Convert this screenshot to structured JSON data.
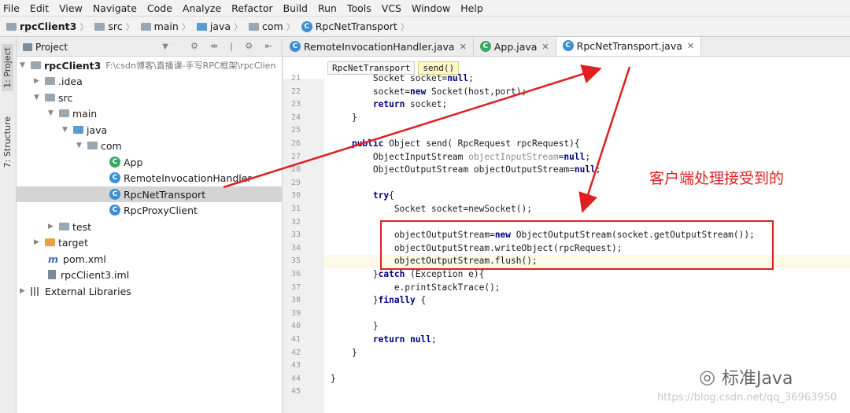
{
  "menu": [
    "File",
    "Edit",
    "View",
    "Navigate",
    "Code",
    "Analyze",
    "Refactor",
    "Build",
    "Run",
    "Tools",
    "VCS",
    "Window",
    "Help"
  ],
  "breadcrumbs": [
    "rpcClient3",
    "src",
    "main",
    "java",
    "com",
    "RpcNetTransport"
  ],
  "side_tabs": {
    "project": "1: Project",
    "structure": "7: Structure"
  },
  "project_panel": {
    "title": "Project",
    "root": {
      "name": "rpcClient3",
      "path": "F:\\csdn博客\\直播课-手写RPC框架\\rpcClien"
    },
    "items": [
      {
        "label": ".idea"
      },
      {
        "label": "src"
      },
      {
        "label": "main"
      },
      {
        "label": "java"
      },
      {
        "label": "com"
      },
      {
        "label": "App"
      },
      {
        "label": "RemoteInvocationHandler"
      },
      {
        "label": "RpcNetTransport"
      },
      {
        "label": "RpcProxyClient"
      },
      {
        "label": "test"
      },
      {
        "label": "target"
      },
      {
        "label": "pom.xml"
      },
      {
        "label": "rpcClient3.iml"
      },
      {
        "label": "External Libraries"
      }
    ]
  },
  "tabs": [
    {
      "label": "RemoteInvocationHandler.java"
    },
    {
      "label": "App.java"
    },
    {
      "label": "RpcNetTransport.java"
    }
  ],
  "editor_crumbs": [
    "RpcNetTransport",
    "send()"
  ],
  "code_lines": [
    {
      "n": "21",
      "t": "        Socket socket=null;"
    },
    {
      "n": "22",
      "t": "        socket=new Socket(host,port);"
    },
    {
      "n": "23",
      "t": "        return socket;"
    },
    {
      "n": "24",
      "t": "    }"
    },
    {
      "n": "25",
      "t": ""
    },
    {
      "n": "26",
      "t": "    public Object send( RpcRequest rpcRequest){"
    },
    {
      "n": "27",
      "t": "        ObjectInputStream objectInputStream=null;"
    },
    {
      "n": "28",
      "t": "        ObjectOutputStream objectOutputStream=null;"
    },
    {
      "n": "29",
      "t": ""
    },
    {
      "n": "30",
      "t": "        try{"
    },
    {
      "n": "31",
      "t": "            Socket socket=newSocket();"
    },
    {
      "n": "32",
      "t": ""
    },
    {
      "n": "33",
      "t": "            objectOutputStream=new ObjectOutputStream(socket.getOutputStream());"
    },
    {
      "n": "34",
      "t": "            objectOutputStream.writeObject(rpcRequest);"
    },
    {
      "n": "35",
      "t": "            objectOutputStream.flush();"
    },
    {
      "n": "36",
      "t": "        }catch (Exception e){"
    },
    {
      "n": "37",
      "t": "            e.printStackTrace();"
    },
    {
      "n": "38",
      "t": "        }finally {"
    },
    {
      "n": "39",
      "t": ""
    },
    {
      "n": "40",
      "t": "        }"
    },
    {
      "n": "41",
      "t": "        return null;"
    },
    {
      "n": "42",
      "t": "    }"
    },
    {
      "n": "43",
      "t": ""
    },
    {
      "n": "44",
      "t": "}"
    },
    {
      "n": "45",
      "t": ""
    }
  ],
  "annotation": "客户端处理接受到的",
  "watermark": {
    "text": "标准Java",
    "url": "https://blog.csdn.net/qq_36963950"
  },
  "colors": {
    "annotation_red": "#e02020",
    "keyword": "#000080",
    "class_icon": "#3d8fd4"
  }
}
